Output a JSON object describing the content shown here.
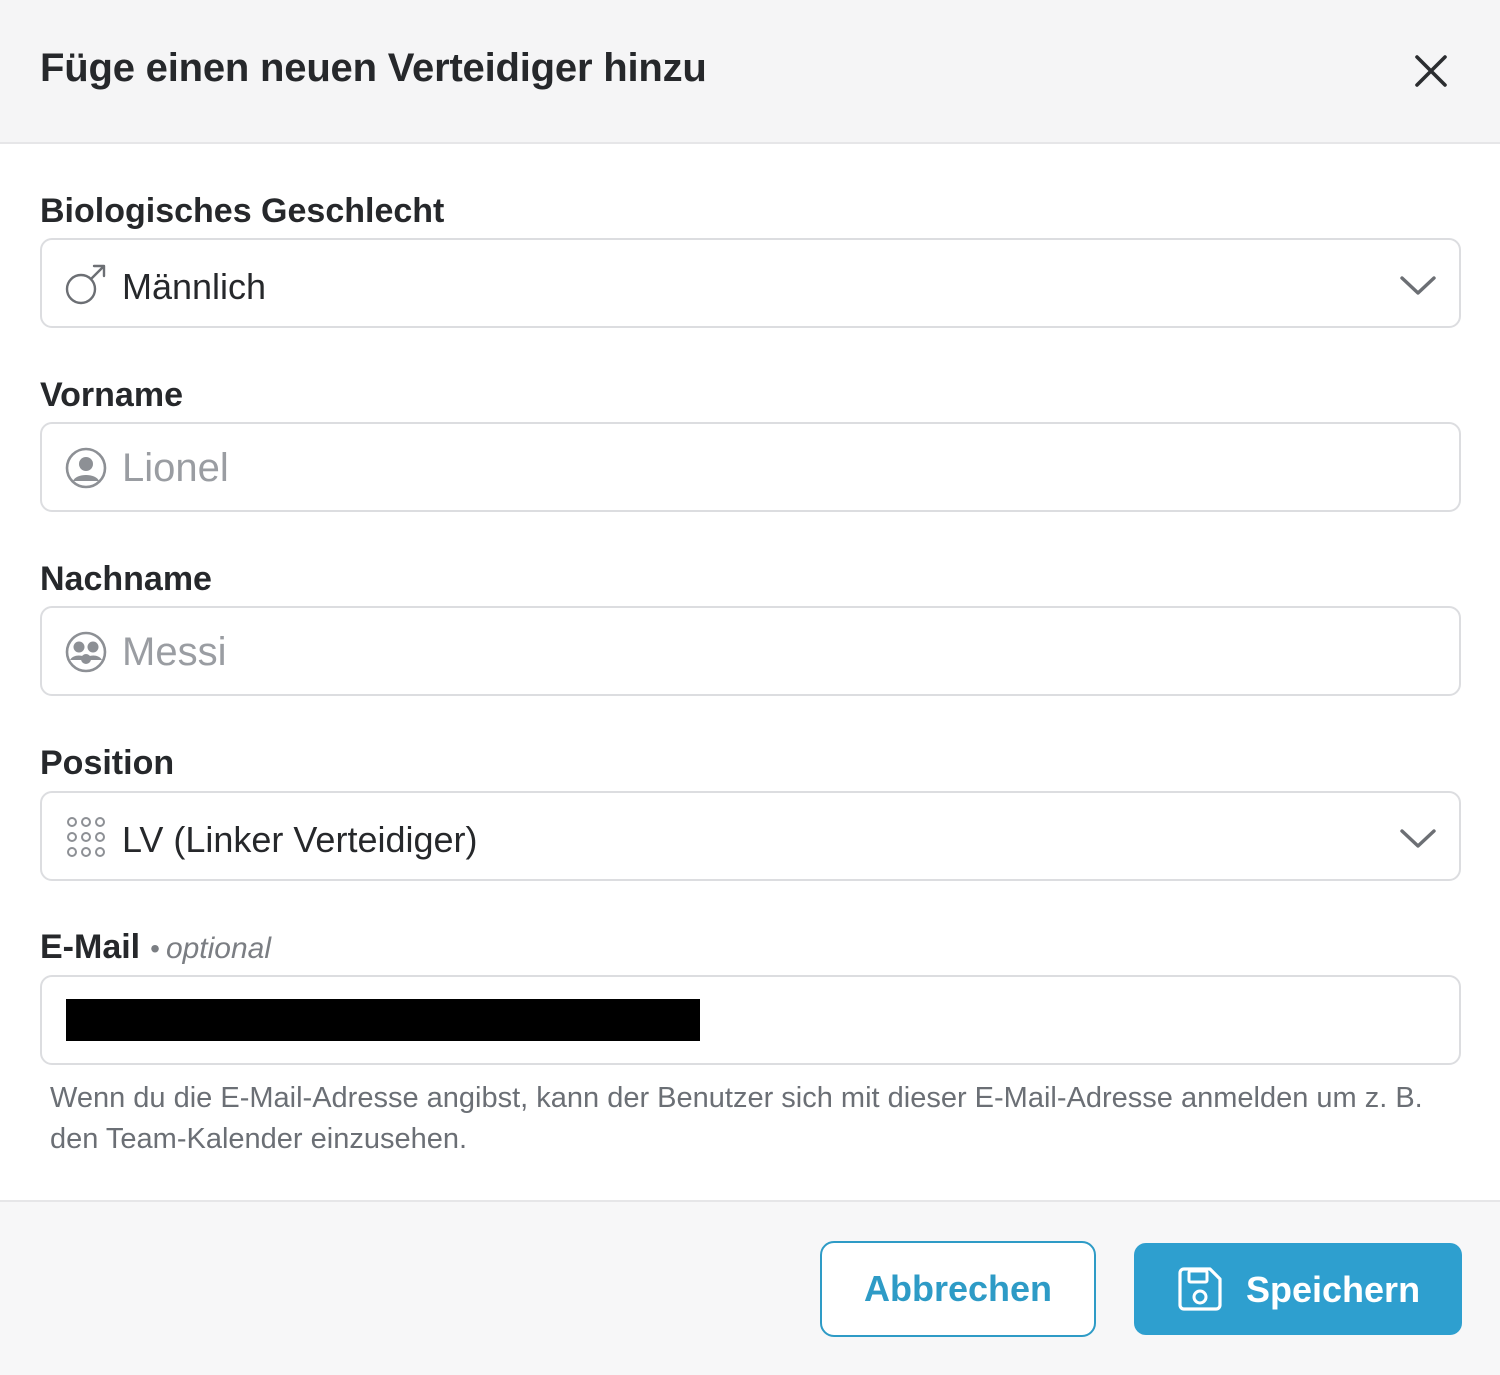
{
  "dialog": {
    "title": "Füge einen neuen Verteidiger hinzu",
    "close_icon": "close-icon"
  },
  "fields": {
    "sex": {
      "label": "Biologisches Geschlecht",
      "value": "Männlich",
      "icon": "male-symbol-icon"
    },
    "first_name": {
      "label": "Vorname",
      "placeholder": "Lionel",
      "icon": "user-circle-icon"
    },
    "last_name": {
      "label": "Nachname",
      "placeholder": "Messi",
      "icon": "user-group-icon"
    },
    "position": {
      "label": "Position",
      "value": "LV (Linker Verteidiger)",
      "icon": "grid-dots-icon"
    },
    "email": {
      "label": "E-Mail",
      "optional": "optional",
      "value_redacted": true,
      "helper": "Wenn du die E-Mail-Adresse angibst, kann der Benutzer sich mit dieser E-Mail-Adresse anmelden um z. B. den Team-Kalender einzusehen."
    }
  },
  "footer": {
    "cancel_label": "Abbrechen",
    "save_label": "Speichern",
    "save_icon": "floppy-disk-icon"
  },
  "colors": {
    "accent": "#2e9fcf",
    "header_bg": "#f5f5f6",
    "footer_bg": "#f7f7f8",
    "border": "#dcdde0"
  }
}
